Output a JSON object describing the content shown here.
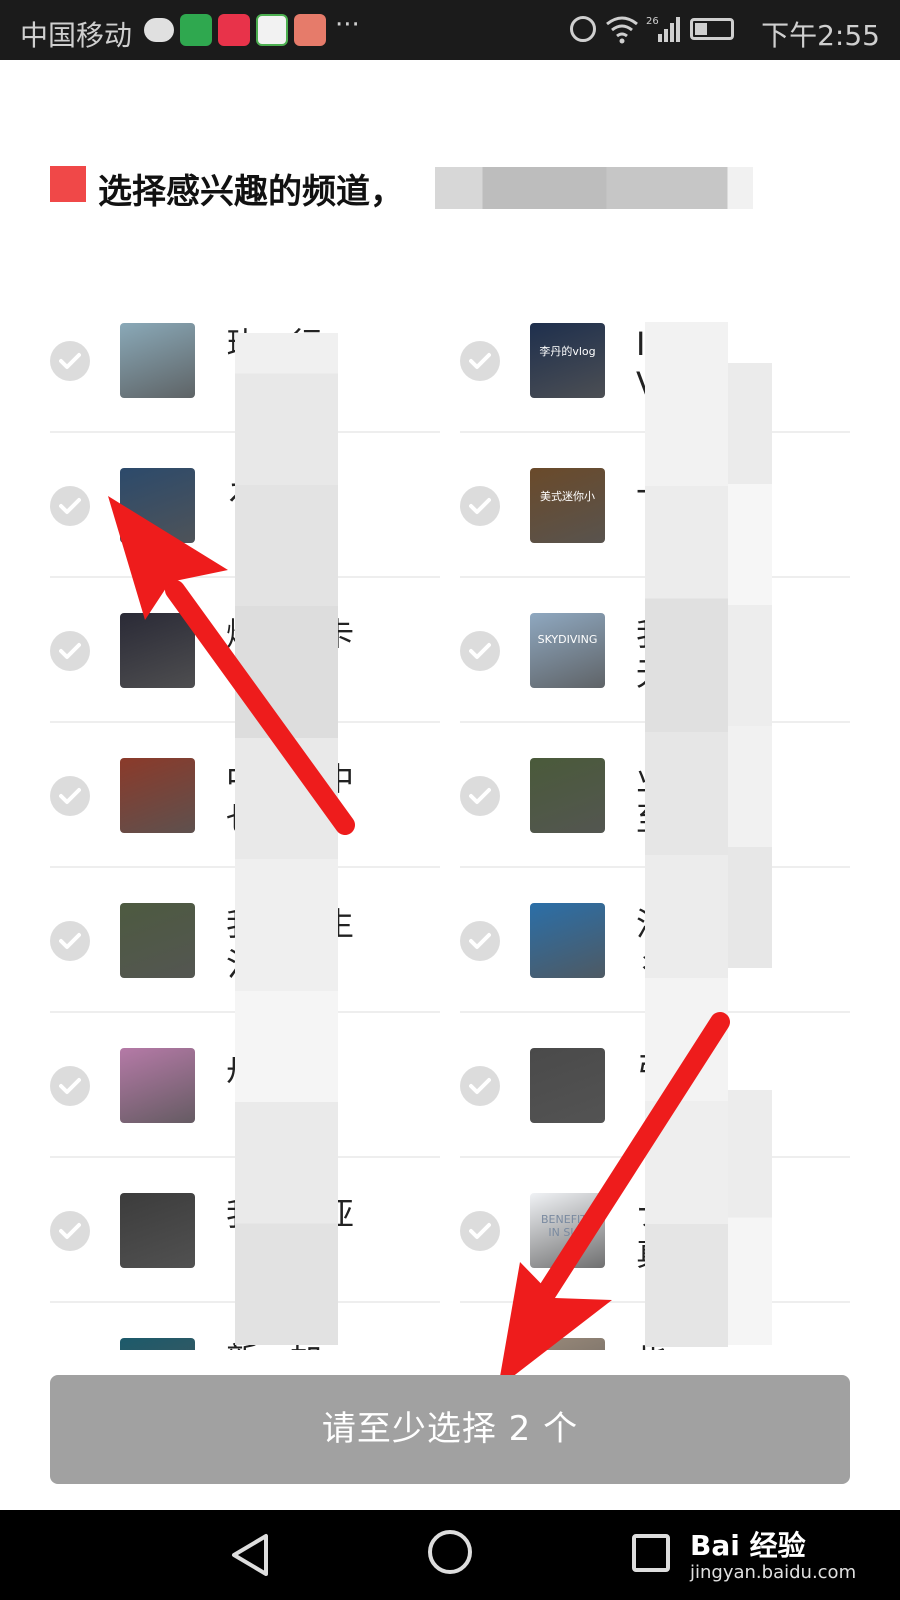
{
  "status_bar": {
    "carrier": "中国移动",
    "more_dots": "···",
    "network": "26",
    "time": "下午2:55"
  },
  "heading": "选择感兴趣的频道，",
  "channels": {
    "left": [
      {
        "label": "玏…行",
        "thumb_color": "#8aa9b8"
      },
      {
        "label": "え…国",
        "thumb_color": "#2c4a6b"
      },
      {
        "label": "炩…的卡",
        "thumb_color": "#2a2a36"
      },
      {
        "label": "中…的中\n乜",
        "thumb_color": "#8b3a2a"
      },
      {
        "label": "我…世生\n氵",
        "thumb_color": "#4d5a40"
      },
      {
        "label": "舟…人",
        "thumb_color": "#b57aa7"
      },
      {
        "label": "我…南亚",
        "thumb_color": "#3c3c3c"
      },
      {
        "label": "新…加",
        "thumb_color": "#1c5a6b"
      }
    ],
    "right": [
      {
        "label": "I\nV",
        "thumb_color": "#1e2f4d",
        "thumb_text": "李丹的vlog"
      },
      {
        "label": "-",
        "thumb_color": "#6a4a2a",
        "thumb_text": "美式迷你小"
      },
      {
        "label": "我…不\n无",
        "thumb_color": "#8fa8c0",
        "thumb_text": "SKYDIVING"
      },
      {
        "label": "业…行\n至",
        "thumb_color": "#4a5a3a"
      },
      {
        "label": "注…美\n彳",
        "thumb_color": "#2b6fa8"
      },
      {
        "label": "弓",
        "thumb_color": "#4a4a4a"
      },
      {
        "label": "ナ…的\n真",
        "thumb_color": "#f0f2f5",
        "thumb_text": "BENEFITS IN SUN"
      },
      {
        "label": "也…一",
        "thumb_color": "#9a8a7a"
      }
    ]
  },
  "button_label": "请至少选择 2 个",
  "watermark": {
    "brand": "Bai 经验",
    "url": "jingyan.baidu.com"
  },
  "colors": {
    "accent_square": "#f04848",
    "button_bg": "#a1a1a1",
    "arrow": "#ee1c1c"
  }
}
